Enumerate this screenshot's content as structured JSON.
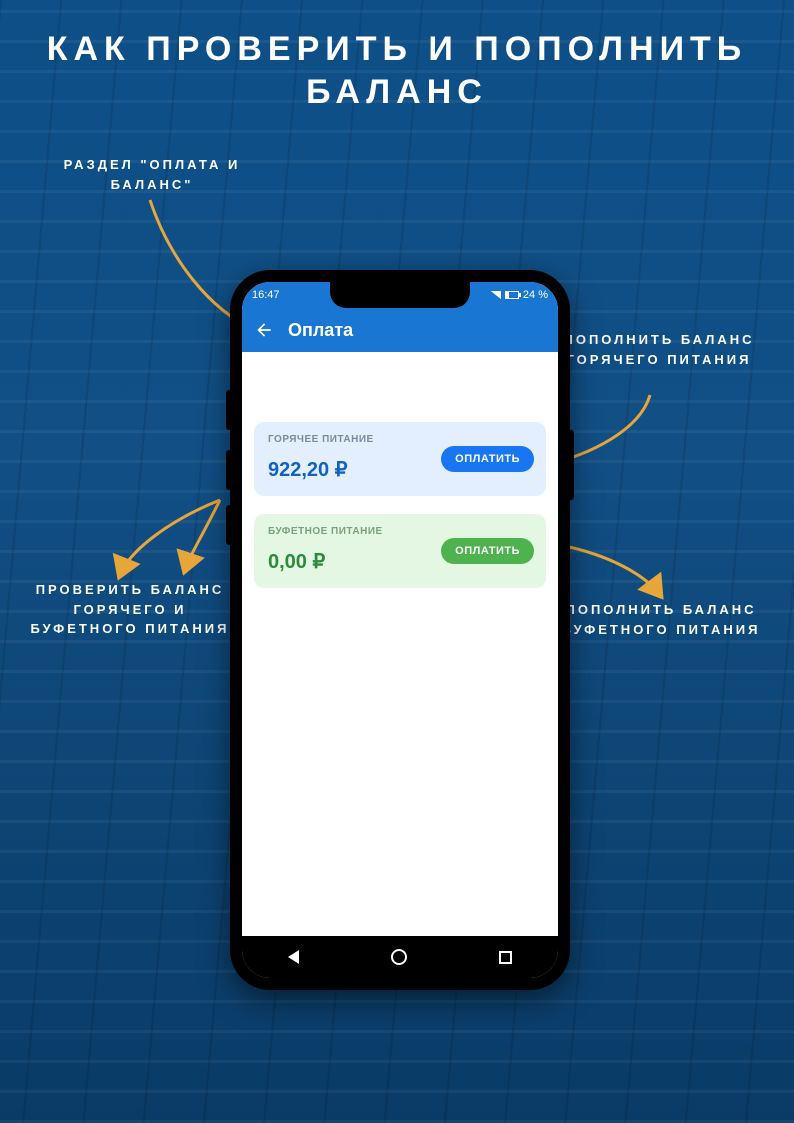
{
  "page_title": "КАК ПРОВЕРИТЬ И ПОПОЛНИТЬ БАЛАНС",
  "annotations": {
    "section": "РАЗДЕЛ \"ОПЛАТА И БАЛАНС\"",
    "topup_hot": "ПОПОЛНИТЬ БАЛАНС ГОРЯЧЕГО ПИТАНИЯ",
    "check_balance": "ПРОВЕРИТЬ БАЛАНС ГОРЯЧЕГО И БУФЕТНОГО ПИТАНИЯ",
    "topup_buffet": "ПОПОЛНИТЬ БАЛАНС БУФЕТНОГО ПИТАНИЯ"
  },
  "status": {
    "time": "16:47",
    "battery": "24 %"
  },
  "app_bar": {
    "title": "Оплата"
  },
  "cards": {
    "hot": {
      "label": "ГОРЯЧЕЕ ПИТАНИЕ",
      "amount": "922,20 ₽",
      "button": "ОПЛАТИТЬ"
    },
    "buffet": {
      "label": "БУФЕТНОЕ ПИТАНИЕ",
      "amount": "0,00 ₽",
      "button": "ОПЛАТИТЬ"
    }
  }
}
